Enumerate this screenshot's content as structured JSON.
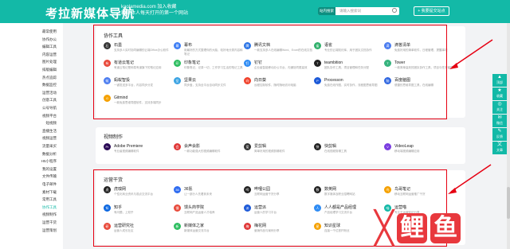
{
  "header": {
    "logo": "考拉新媒体导航",
    "site_url": "kaolamedia.com",
    "bookmark": "加入收藏",
    "tagline": "新媒体人每天打开的第一个网站",
    "search_select": "站内搜索",
    "search_placeholder": "请输入搜索词",
    "submit_label": "我要提交站点"
  },
  "sidebar": {
    "items": [
      "最常使用",
      "协作办公",
      "编辑工具",
      "内容运营",
      "图片处理",
      "排版编辑",
      "热点追踪",
      "数据监控",
      "运营活动",
      "创意工具",
      "公号导航",
      "视频平台",
      "短视频",
      "直播生活",
      "视频运营",
      "流量采买",
      "数据分析",
      "H5小程序",
      "我的设置",
      "文件传输",
      "电子邮件",
      "素材下载",
      "常用工具",
      "协作工具",
      "视频制作",
      "运营干货",
      "运营策划"
    ],
    "active_index": 23
  },
  "sections": [
    {
      "title": "协作工具",
      "items": [
        {
          "name": "石墨",
          "desc": "支持多人实时协同编辑的云端Office办公软件",
          "icon": "石",
          "color": "#333333"
        },
        {
          "name": "幕布",
          "desc": "用最好的方式整理你的大脑，较好地分类内容和笔记",
          "icon": "幕",
          "color": "#3d7ef5"
        },
        {
          "name": "腾讯文档",
          "desc": "一款支持多人在线编辑Word、Excel的在线文档",
          "icon": "腾",
          "color": "#2b74e6"
        },
        {
          "name": "语雀",
          "desc": "专业的云端知识库，用于团队文档协作",
          "icon": "雀",
          "color": "#31b16c"
        },
        {
          "name": "滴答清单",
          "desc": "免费好用的清单软件，日程管理、提醒事项",
          "icon": "滴",
          "color": "#4a7cf0"
        },
        {
          "name": "有道云笔记",
          "desc": "有道云笔记是网易有道旗下的笔记应用",
          "icon": "有",
          "color": "#e84a3b"
        },
        {
          "name": "印象笔记",
          "desc": "印象笔记，记录一切，工作学习生活的笔记工具",
          "icon": "印",
          "color": "#2dbe60"
        },
        {
          "name": "钉钉",
          "desc": "企业级智能移动办公平台，沟通协同更高效",
          "icon": "钉",
          "color": "#2f8cf4"
        },
        {
          "name": "teambition",
          "desc": "团队协作工具，项目管理和任务分配",
          "icon": "T",
          "color": "#222222"
        },
        {
          "name": "Tower",
          "desc": "一款简单高效的团队协作工具，项目与任务管理",
          "icon": "T",
          "color": "#36b37e"
        },
        {
          "name": "蚂蚁智投",
          "desc": "一键发送多平台，内容同步分发",
          "icon": "蚁",
          "color": "#4c7df0"
        },
        {
          "name": "坚果云",
          "desc": "同步盘，支持全平台自动同步文件",
          "icon": "坚",
          "color": "#3aa3e3"
        },
        {
          "name": "向日葵",
          "desc": "远程控制软件，随时随地访问电脑",
          "icon": "向",
          "color": "#f0422c"
        },
        {
          "name": "Processon",
          "desc": "免费在线作图，实时协作，流程图思维导图",
          "icon": "P",
          "color": "#1d5ad8"
        },
        {
          "name": "百度脑图",
          "desc": "便捷的思维导图工具，在线编辑",
          "icon": "脑",
          "color": "#2f66e0"
        },
        {
          "name": "Gitmind",
          "desc": "一款免费思维导图软件，支持多端同步",
          "icon": "G",
          "color": "#f5a100"
        }
      ]
    },
    {
      "title": "视频制作",
      "items": [
        {
          "name": "Adobe Premiere",
          "desc": "专业级视频编辑软件",
          "icon": "Pr",
          "color": "#2a0a55"
        },
        {
          "name": "会声会影",
          "desc": "一款功能强大的视频编辑软件",
          "icon": "会",
          "color": "#e03838"
        },
        {
          "name": "爱剪辑",
          "desc": "简单好用的视频剪辑软件",
          "icon": "爱",
          "color": "#333333"
        },
        {
          "name": "快剪辑",
          "desc": "在线视频剪辑工具",
          "icon": "快",
          "color": "#222222"
        },
        {
          "name": "VideoLeap",
          "desc": "移动端视频编辑应用",
          "icon": "V",
          "color": "#7b3ee0"
        }
      ]
    },
    {
      "title": "运营干货",
      "items": [
        {
          "name": "虎嗅网",
          "desc": "个性化商业资讯与观点交流平台",
          "icon": "虎",
          "color": "#222222"
        },
        {
          "name": "36氪",
          "desc": "让一部分人先看到未来",
          "icon": "36",
          "color": "#2f6cf0"
        },
        {
          "name": "哔哩公园",
          "desc": "互联网运营干货分享",
          "icon": "哔",
          "color": "#222222"
        },
        {
          "name": "数英网",
          "desc": "数字媒体及职业招聘网站",
          "icon": "数",
          "color": "#222222"
        },
        {
          "name": "鸟哥笔记",
          "desc": "移动互联网运营推广干货",
          "icon": "鸟",
          "color": "#f5a100"
        },
        {
          "name": "知乎",
          "desc": "有问题，上知乎",
          "icon": "知",
          "color": "#0a66e0"
        },
        {
          "name": "馒头商学院",
          "desc": "互联网产品运营人才培养",
          "icon": "馒",
          "color": "#e84a3b"
        },
        {
          "name": "运营派",
          "desc": "运营人的学习平台",
          "icon": "派",
          "color": "#1d5ad8"
        },
        {
          "name": "人人都是产品经理",
          "desc": "产品经理学习交流平台",
          "icon": "人",
          "color": "#2f8cf4"
        },
        {
          "name": "运营喵",
          "desc": "专注于运营知识分享",
          "icon": "喵",
          "color": "#13b9a7"
        },
        {
          "name": "运营研究社",
          "desc": "运营人成长社区",
          "icon": "研",
          "color": "#e84a3b"
        },
        {
          "name": "新媒体之家",
          "desc": "新媒体运营交流平台",
          "icon": "新",
          "color": "#2dbe60"
        },
        {
          "name": "梅花网",
          "desc": "营销作品与案例分享",
          "icon": "梅",
          "color": "#e03838"
        },
        {
          "name": "知识星球",
          "desc": "连接一千位铁杆粉丝",
          "icon": "星",
          "color": "#f5a100"
        }
      ]
    }
  ],
  "float_bar": [
    {
      "label": "顶部",
      "icon": "▲"
    },
    {
      "label": "收藏",
      "icon": "★"
    },
    {
      "label": "关注",
      "icon": "◎"
    },
    {
      "label": "微信",
      "icon": "✉"
    },
    {
      "label": "反馈",
      "icon": "✎"
    },
    {
      "label": "文章",
      "icon": "文"
    }
  ],
  "watermark": {
    "text": "鲤鱼",
    "colors": {
      "accent": "#e8383d"
    }
  },
  "colors": {
    "brand": "#13b9a7",
    "highlight": "#e60012"
  }
}
